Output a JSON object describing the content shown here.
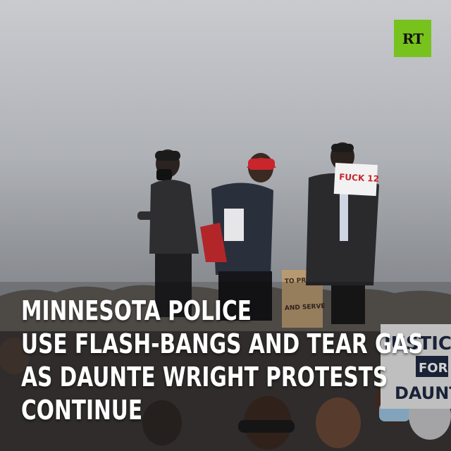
{
  "logo": {
    "text": "RT",
    "color": "#78c21e"
  },
  "headline": {
    "lines": [
      "MINNESOTA POLICE",
      "USE FLASH-BANGS AND TEAR GAS",
      "AS DAUNTE WRIGHT PROTESTS",
      "CONTINUE"
    ]
  },
  "signs": {
    "held_sign": "FUCK 12",
    "cardboard_sign_1": "TO PROTECT",
    "cardboard_sign_2": "AND SERVE",
    "right_sign_1": "JUSTICE",
    "right_sign_2": "FOR",
    "right_sign_3": "DAUNTE"
  }
}
